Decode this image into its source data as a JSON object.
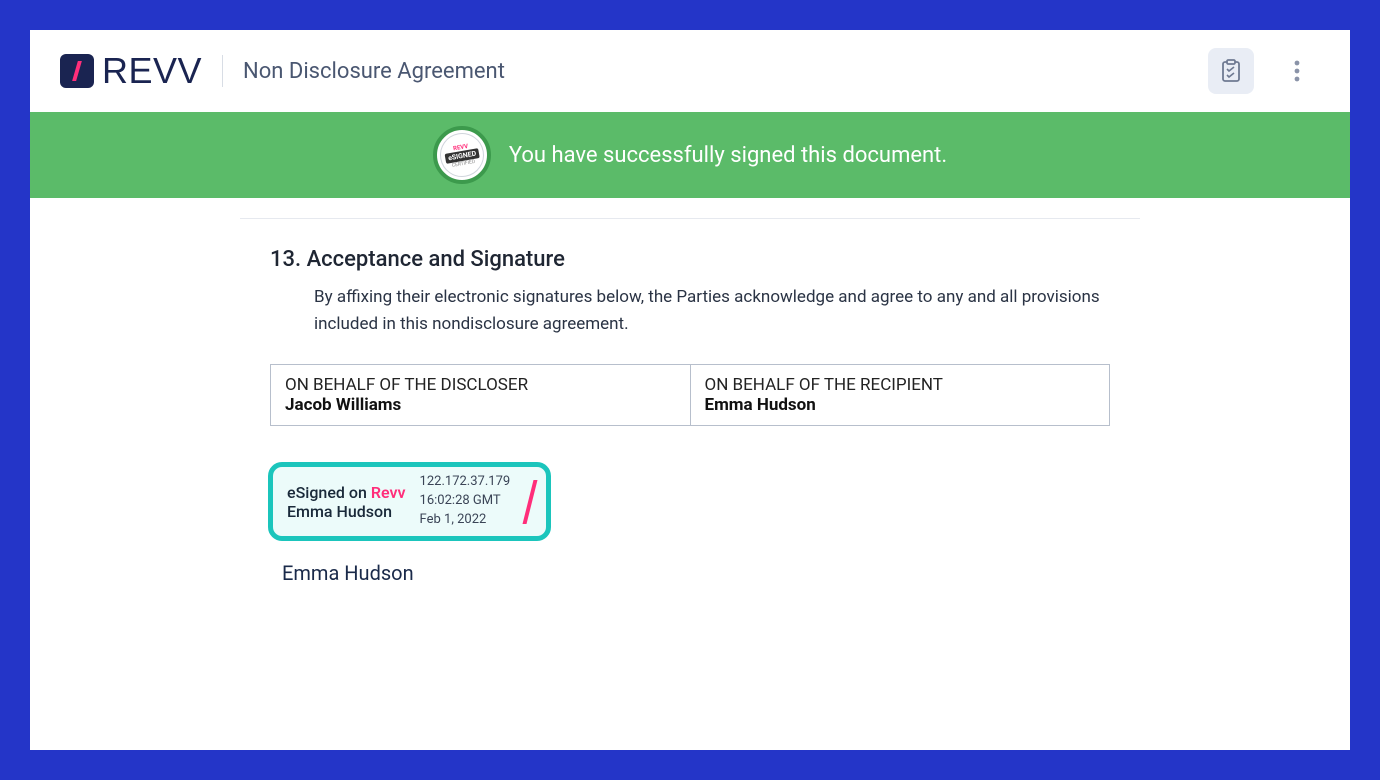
{
  "brand": {
    "name": "REVV"
  },
  "doc": {
    "title": "Non Disclosure Agreement"
  },
  "banner": {
    "message": "You have successfully signed this document.",
    "stamp_text": "eSIGNED",
    "stamp_top": "REVV",
    "stamp_bottom": "CERTIFIED"
  },
  "section": {
    "heading": "13. Acceptance and Signature",
    "body": "By affixing their electronic signatures below, the Parties acknowledge and agree to any and all provisions included in this nondisclosure agreement."
  },
  "parties": {
    "discloser": {
      "role": "ON BEHALF OF THE DISCLOSER",
      "name": "Jacob Williams"
    },
    "recipient": {
      "role": "ON BEHALF OF THE RECIPIENT",
      "name": "Emma Hudson"
    }
  },
  "esign": {
    "prefix": "eSigned on ",
    "brand": "Revv",
    "signer": "Emma Hudson",
    "ip": "122.172.37.179",
    "time": "16:02:28 GMT",
    "date": "Feb 1, 2022"
  },
  "signer_label": "Emma Hudson"
}
